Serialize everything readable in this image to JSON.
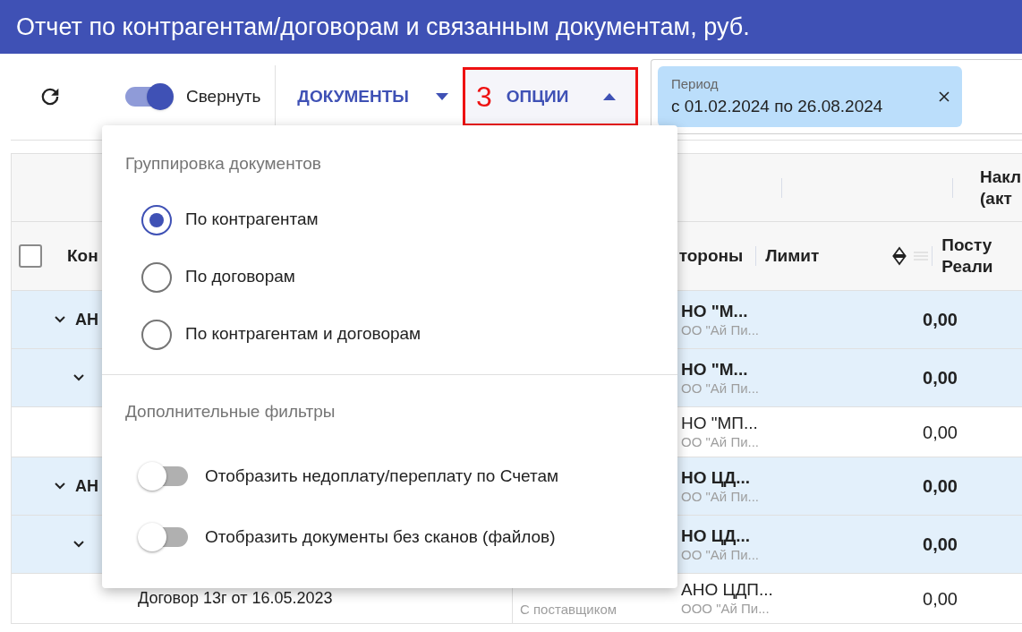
{
  "title": "Отчет по контрагентам/договорам и связанным документам, руб.",
  "toolbar": {
    "collapse": {
      "label": "Свернуть",
      "on": true
    },
    "documents_menu": {
      "label": "ДОКУМЕНТЫ",
      "expanded": false
    },
    "options_menu": {
      "badge": "3",
      "label": "ОПЦИИ",
      "expanded": true
    },
    "period": {
      "label": "Период",
      "value": "с 01.02.2024 по 26.08.2024"
    }
  },
  "options_popup": {
    "grouping": {
      "heading": "Группировка документов",
      "options": [
        {
          "label": "По контрагентам",
          "selected": true
        },
        {
          "label": "По договорам",
          "selected": false
        },
        {
          "label": "По контрагентам и договорам",
          "selected": false
        }
      ]
    },
    "filters": {
      "heading": "Дополнительные фильтры",
      "items": [
        {
          "label": "Отобразить недоплату/переплату по Счетам",
          "on": false
        },
        {
          "label": "Отобразить документы без сканов (файлов)",
          "on": false
        }
      ]
    }
  },
  "table": {
    "header_group": [
      "Накл",
      "(акт"
    ],
    "select_all": {
      "checked": false
    },
    "columns": {
      "name": "Кон",
      "sides": "тороны",
      "limit": "Лимит",
      "column_5": [
        "Посту",
        "Реали"
      ]
    },
    "rows": [
      {
        "kind": "group",
        "expanded": true,
        "name": "АН",
        "sides": [
          "НО \"М...",
          "ОО \"Ай Пи..."
        ],
        "limit": "0,00",
        "children": [
          {
            "kind": "group",
            "expanded": true,
            "sides": [
              "НО \"М...",
              "ОО \"Ай Пи..."
            ],
            "limit": "0,00",
            "children": [
              {
                "kind": "item",
                "sides": [
                  "НО \"МП...",
                  "ОО \"Ай Пи..."
                ],
                "limit": "0,00"
              }
            ]
          }
        ]
      },
      {
        "kind": "group",
        "expanded": true,
        "name": "АН",
        "sides": [
          "НО ЦД...",
          "ОО \"Ай Пи..."
        ],
        "limit": "0,00",
        "children": [
          {
            "kind": "group",
            "expanded": true,
            "sides": [
              "НО ЦД...",
              "ОО \"Ай Пи..."
            ],
            "limit": "0,00",
            "children": [
              {
                "kind": "item",
                "name": "Договор 13г от 16.05.2023",
                "type": "С поставщиком",
                "sides": [
                  "АНО ЦДП...",
                  "ООО \"Ай Пи..."
                ],
                "limit": "0,00"
              }
            ]
          }
        ]
      }
    ]
  }
}
